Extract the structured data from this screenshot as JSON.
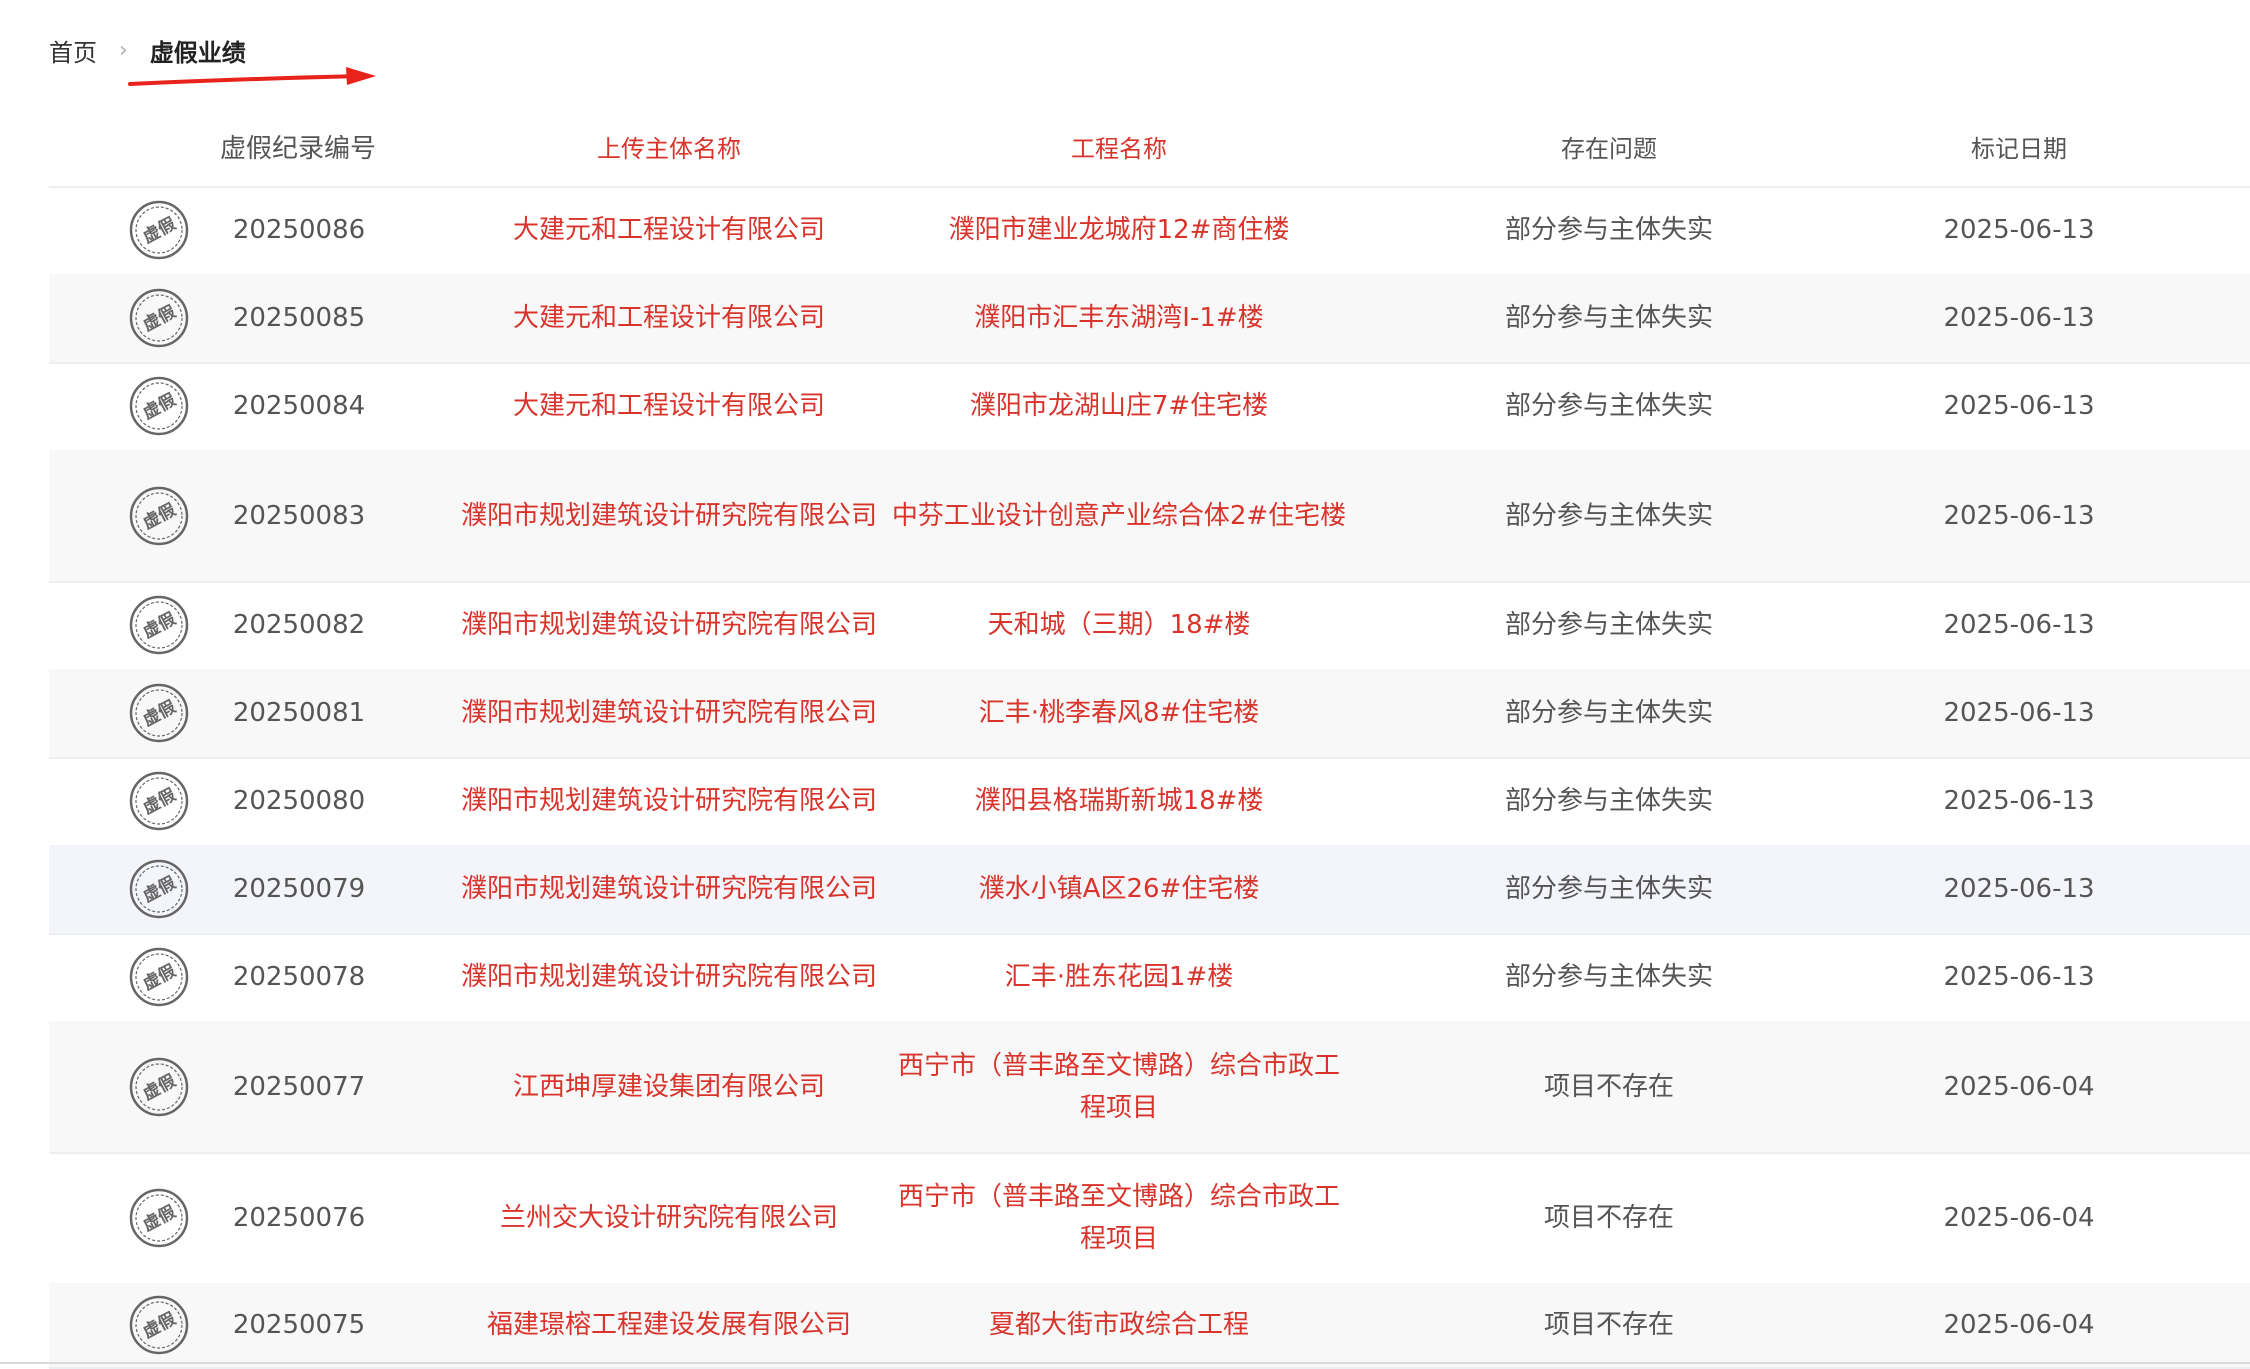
{
  "breadcrumb": {
    "home": "首页",
    "separator": "›",
    "current": "虚假业绩"
  },
  "table": {
    "headers": {
      "id": "虚假纪录编号",
      "org": "上传主体名称",
      "project": "工程名称",
      "problem": "存在问题",
      "date": "标记日期"
    },
    "stamp_label": "虚假",
    "rows": [
      {
        "id": "20250086",
        "org": "大建元和工程设计有限公司",
        "project": "濮阳市建业龙城府12#商住楼",
        "problem": "部分参与主体失实",
        "date": "2025-06-13"
      },
      {
        "id": "20250085",
        "org": "大建元和工程设计有限公司",
        "project": "濮阳市汇丰东湖湾Ⅰ-1#楼",
        "problem": "部分参与主体失实",
        "date": "2025-06-13"
      },
      {
        "id": "20250084",
        "org": "大建元和工程设计有限公司",
        "project": "濮阳市龙湖山庄7#住宅楼",
        "problem": "部分参与主体失实",
        "date": "2025-06-13"
      },
      {
        "id": "20250083",
        "org": "濮阳市规划建筑设计研究院有限公司",
        "project": "中芬工业设计创意产业综合体2#住宅楼",
        "problem": "部分参与主体失实",
        "date": "2025-06-13"
      },
      {
        "id": "20250082",
        "org": "濮阳市规划建筑设计研究院有限公司",
        "project": "天和城（三期）18#楼",
        "problem": "部分参与主体失实",
        "date": "2025-06-13"
      },
      {
        "id": "20250081",
        "org": "濮阳市规划建筑设计研究院有限公司",
        "project": "汇丰·桃李春风8#住宅楼",
        "problem": "部分参与主体失实",
        "date": "2025-06-13"
      },
      {
        "id": "20250080",
        "org": "濮阳市规划建筑设计研究院有限公司",
        "project": "濮阳县格瑞斯新城18#楼",
        "problem": "部分参与主体失实",
        "date": "2025-06-13"
      },
      {
        "id": "20250079",
        "org": "濮阳市规划建筑设计研究院有限公司",
        "project": "濮水小镇A区26#住宅楼",
        "problem": "部分参与主体失实",
        "date": "2025-06-13"
      },
      {
        "id": "20250078",
        "org": "濮阳市规划建筑设计研究院有限公司",
        "project": "汇丰·胜东花园1#楼",
        "problem": "部分参与主体失实",
        "date": "2025-06-13"
      },
      {
        "id": "20250077",
        "org": "江西坤厚建设集团有限公司",
        "project": "西宁市（普丰路至文博路）综合市政工程项目",
        "problem": "项目不存在",
        "date": "2025-06-04"
      },
      {
        "id": "20250076",
        "org": "兰州交大设计研究院有限公司",
        "project": "西宁市（普丰路至文博路）综合市政工程项目",
        "problem": "项目不存在",
        "date": "2025-06-04"
      },
      {
        "id": "20250075",
        "org": "福建璟榕工程建设发展有限公司",
        "project": "夏都大街市政综合工程",
        "problem": "项目不存在",
        "date": "2025-06-04"
      }
    ]
  },
  "colors": {
    "link_red": "#d9342b",
    "header_gray": "#888888",
    "row_alt": "#f8f8f9",
    "annotation_arrow": "#e8231c"
  }
}
